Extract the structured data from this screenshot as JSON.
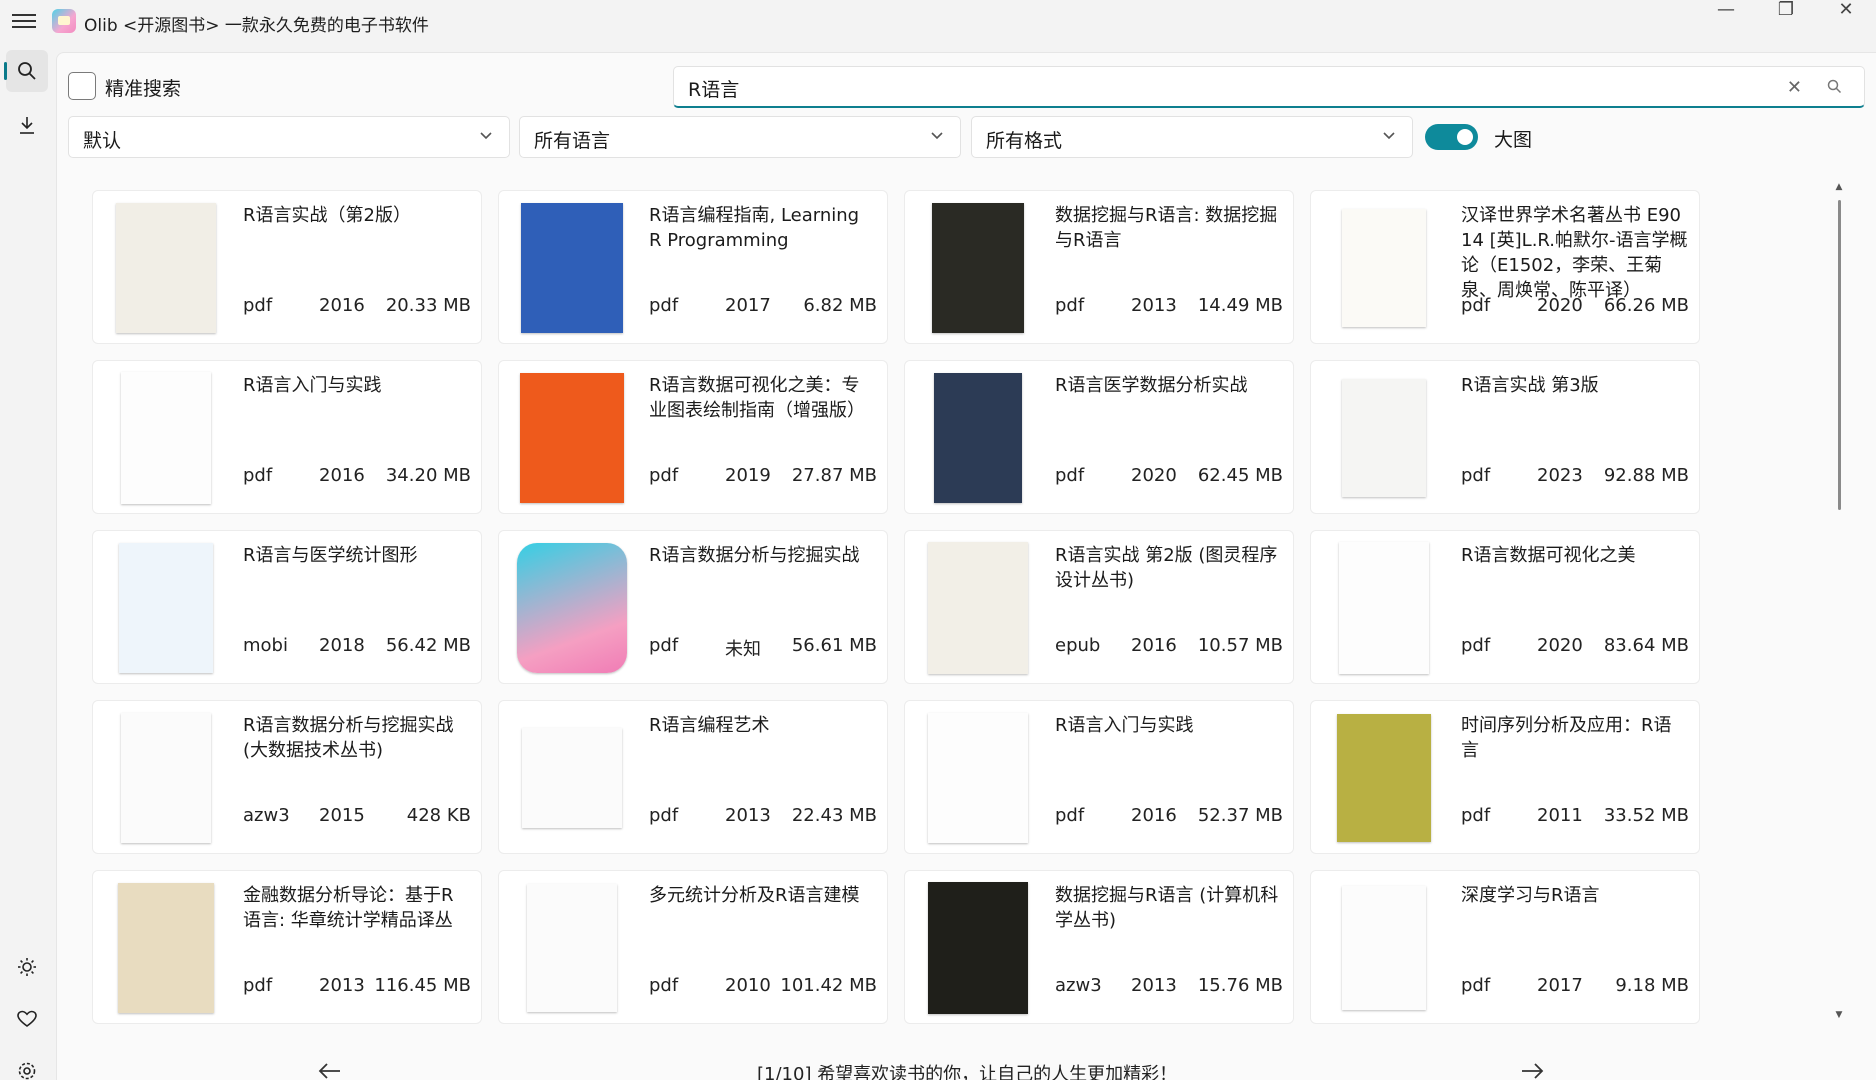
{
  "titlebar": {
    "title": "Olib <开源图书> 一款永久免费的电子书软件",
    "minimize": "—",
    "restore": "❐",
    "close": "✕"
  },
  "nav": {
    "icons": [
      "search-icon",
      "download-icon",
      "theme-icon",
      "heart-icon",
      "settings-icon"
    ]
  },
  "filters": {
    "exact_search_label": "精准搜索",
    "exact_search_checked": false,
    "search_value": "R语言",
    "sort": "默认",
    "language": "所有语言",
    "format": "所有格式",
    "big_image_label": "大图",
    "big_image_on": true
  },
  "books": [
    {
      "title": "R语言实战（第2版）",
      "format": "pdf",
      "year": "2016",
      "size": "20.33 MB"
    },
    {
      "title": "R语言编程指南, Learning R Programming",
      "format": "pdf",
      "year": "2017",
      "size": "6.82 MB"
    },
    {
      "title": "数据挖掘与R语言: 数据挖掘与R语言",
      "format": "pdf",
      "year": "2013",
      "size": "14.49 MB"
    },
    {
      "title": "汉译世界学术名著丛书 E9014 [英]L.R.帕默尔-语言学概论（E1502，李荣、王菊泉、周焕常、陈平译）",
      "format": "pdf",
      "year": "2020",
      "size": "66.26 MB"
    },
    {
      "title": "R语言入门与实践",
      "format": "pdf",
      "year": "2016",
      "size": "34.20 MB"
    },
    {
      "title": "R语言数据可视化之美：专业图表绘制指南（增强版）",
      "format": "pdf",
      "year": "2019",
      "size": "27.87 MB"
    },
    {
      "title": "R语言医学数据分析实战",
      "format": "pdf",
      "year": "2020",
      "size": "62.45 MB"
    },
    {
      "title": "R语言实战 第3版",
      "format": "pdf",
      "year": "2023",
      "size": "92.88 MB"
    },
    {
      "title": "R语言与医学统计图形",
      "format": "mobi",
      "year": "2018",
      "size": "56.42 MB"
    },
    {
      "title": "R语言数据分析与挖掘实战",
      "format": "pdf",
      "year": "未知",
      "size": "56.61 MB"
    },
    {
      "title": "R语言实战 第2版 (图灵程序设计丛书)",
      "format": "epub",
      "year": "2016",
      "size": "10.57 MB"
    },
    {
      "title": "R语言数据可视化之美",
      "format": "pdf",
      "year": "2020",
      "size": "83.64 MB"
    },
    {
      "title": "R语言数据分析与挖掘实战 (大数据技术丛书)",
      "format": "azw3",
      "year": "2015",
      "size": "428 KB"
    },
    {
      "title": "R语言编程艺术",
      "format": "pdf",
      "year": "2013",
      "size": "22.43 MB"
    },
    {
      "title": "R语言入门与实践",
      "format": "pdf",
      "year": "2016",
      "size": "52.37 MB"
    },
    {
      "title": "时间序列分析及应用：R语言",
      "format": "pdf",
      "year": "2011",
      "size": "33.52 MB"
    },
    {
      "title": "金融数据分析导论：基于R语言: 华章统计学精品译丛",
      "format": "pdf",
      "year": "2013",
      "size": "116.45 MB"
    },
    {
      "title": "多元统计分析及R语言建模",
      "format": "pdf",
      "year": "2010",
      "size": "101.42 MB"
    },
    {
      "title": "数据挖掘与R语言 (计算机科学丛书)",
      "format": "azw3",
      "year": "2013",
      "size": "15.76 MB"
    },
    {
      "title": "深度学习与R语言",
      "format": "pdf",
      "year": "2017",
      "size": "9.18 MB"
    }
  ],
  "footer": {
    "text": "[1/10] 希望喜欢读书的你，让自己的人生更加精彩！"
  }
}
